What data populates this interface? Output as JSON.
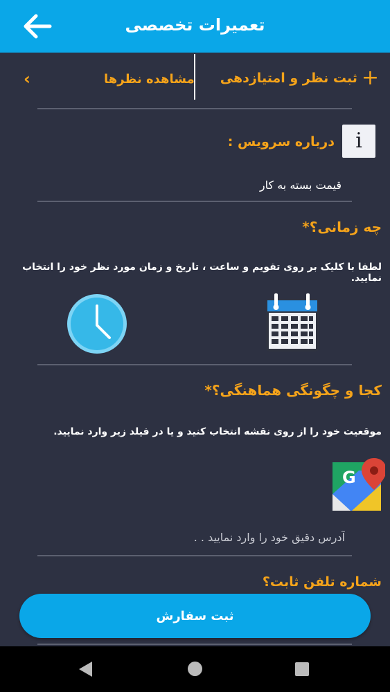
{
  "appbar": {
    "title": "تعمیرات تخصصی",
    "back_icon": "arrow-left-icon"
  },
  "reviews": {
    "add_label": "ثبت نظر و امتیازدهی",
    "view_label": "مشاهده نظرها"
  },
  "service": {
    "about_title": "درباره سرویس :",
    "price_text": "قیمت بسته به کار"
  },
  "when": {
    "title": "چه زمانی؟",
    "required_mark": "*",
    "instruction": "لطفا با کلیک بر روی تقویم و ساعت ، تاریخ و زمان مورد نظر خود را انتخاب نمایید."
  },
  "where": {
    "title": "کجا و چگونگی هماهنگی؟",
    "required_mark": "*",
    "instruction": "موقعیت خود را از روی نقشه انتخاب کنید و یا در فیلد زیر وارد نمایید.",
    "address_placeholder": "آدرس دقیق خود را وارد نمایید . ."
  },
  "phone": {
    "title": "شماره تلفن ثابت؟"
  },
  "submit": {
    "label": "ثبت سفارش"
  },
  "colors": {
    "primary": "#0aa7e8",
    "accent": "#f5a31a",
    "background": "#2d3142"
  }
}
